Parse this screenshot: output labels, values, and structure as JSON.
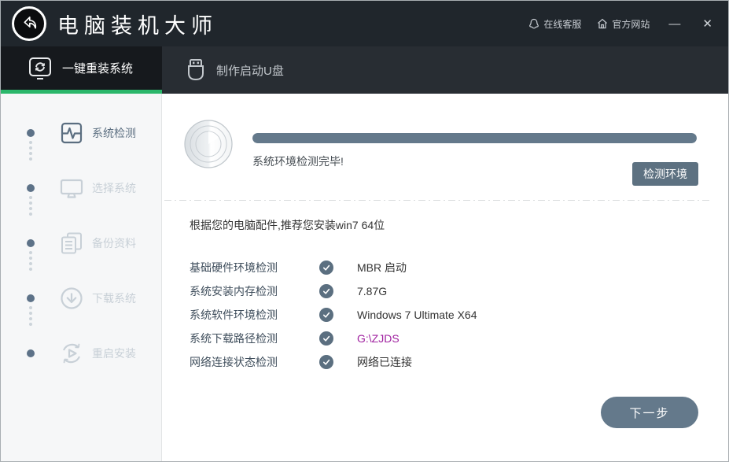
{
  "colors": {
    "titlebar_bg": "#20262c",
    "tabbar_bg": "#282d33",
    "active_tab_bg": "#16191d",
    "accent_green": "#2bb76b",
    "slate": "#64798b",
    "path_highlight": "#a021a0"
  },
  "titlebar": {
    "app_title": "电脑装机大师",
    "links": [
      {
        "label": "在线客服",
        "icon": "qq-service-icon"
      },
      {
        "label": "官方网站",
        "icon": "home-icon"
      }
    ],
    "minimize_label": "—",
    "close_label": "✕"
  },
  "tabs": [
    {
      "label": "一键重装系统",
      "icon": "reinstall-monitor-icon",
      "active": true
    },
    {
      "label": "制作启动U盘",
      "icon": "usb-drive-icon",
      "active": false
    }
  ],
  "sidebar": {
    "steps": [
      {
        "label": "系统检测",
        "icon": "pulse-monitor-icon",
        "state": "active"
      },
      {
        "label": "选择系统",
        "icon": "monitor-icon",
        "state": "pending"
      },
      {
        "label": "备份资料",
        "icon": "documents-icon",
        "state": "pending"
      },
      {
        "label": "下载系统",
        "icon": "download-icon",
        "state": "pending"
      },
      {
        "label": "重启安装",
        "icon": "restart-icon",
        "state": "pending"
      }
    ]
  },
  "main": {
    "progress_percent": 100,
    "status_text": "系统环境检测完毕!",
    "detect_button": "检测环境",
    "recommendation": "根据您的电脑配件,推荐您安装win7 64位",
    "checks": [
      {
        "label": "基础硬件环境检测",
        "status": "ok",
        "value": "MBR 启动"
      },
      {
        "label": "系统安装内存检测",
        "status": "ok",
        "value": "7.87G"
      },
      {
        "label": "系统软件环境检测",
        "status": "ok",
        "value": "Windows 7 Ultimate X64"
      },
      {
        "label": "系统下载路径检测",
        "status": "ok",
        "value": "G:\\ZJDS"
      },
      {
        "label": "网络连接状态检测",
        "status": "ok",
        "value": "网络已连接"
      }
    ],
    "next_button": "下一步"
  }
}
